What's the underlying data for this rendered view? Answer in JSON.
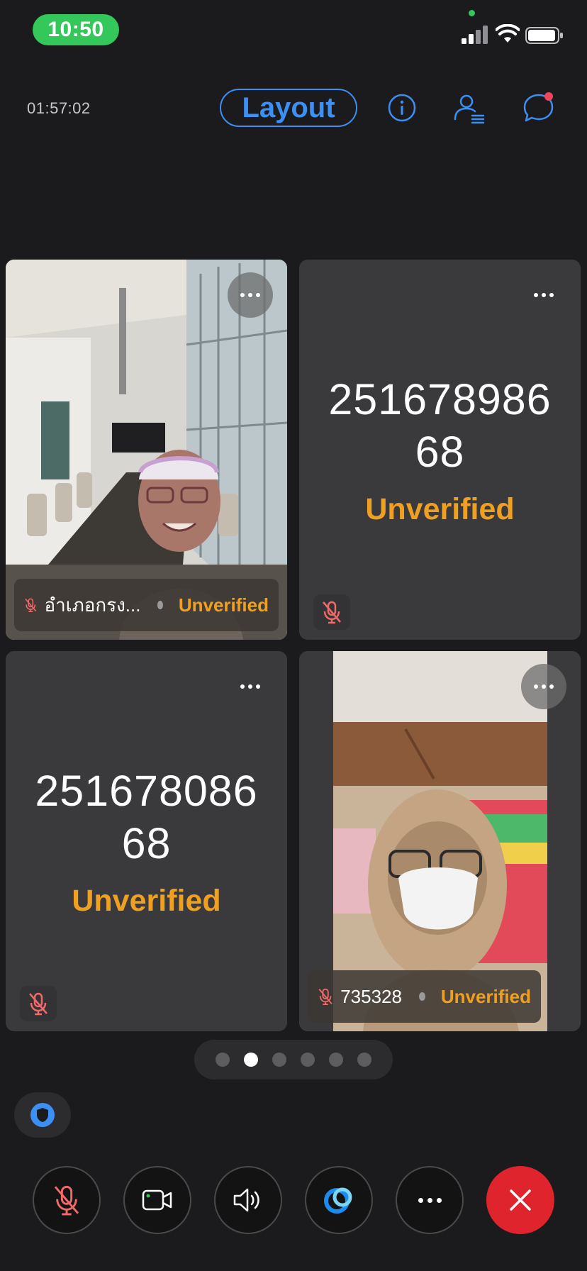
{
  "status_bar": {
    "time": "10:50"
  },
  "header": {
    "elapsed": "01:57:02",
    "layout_label": "Layout"
  },
  "tiles": [
    {
      "name": "อำเภอกรง...",
      "status": "Unverified"
    },
    {
      "number_line1": "251678986",
      "number_line2": "68",
      "status": "Unverified"
    },
    {
      "number_line1": "251678086",
      "number_line2": "68",
      "status": "Unverified"
    },
    {
      "name": "735328",
      "status": "Unverified"
    }
  ],
  "pager": {
    "count": 6,
    "active_index": 1
  },
  "controls": [
    "mic-muted-icon",
    "video-icon",
    "speaker-icon",
    "webex-assistant-icon",
    "more-icon",
    "end-call-icon"
  ],
  "colors": {
    "accent": "#3b8ff5",
    "unverified": "#f0a020",
    "end": "#e0242d",
    "mute": "#f06a6a"
  }
}
